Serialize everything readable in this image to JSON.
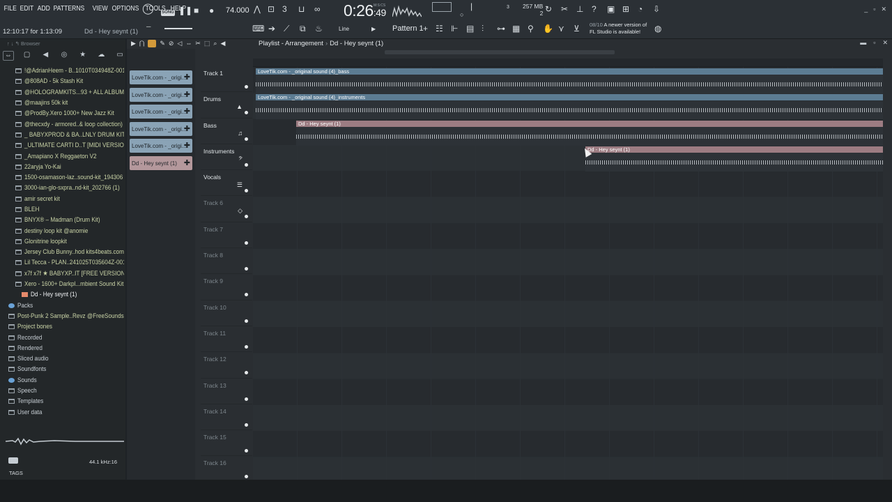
{
  "menu": [
    "FILE",
    "EDIT",
    "ADD",
    "PATTERNS",
    "VIEW",
    "OPTIONS",
    "TOOLS",
    "HELP"
  ],
  "hint": {
    "time": "12:10:17 for 1:13:09",
    "project": "Dd - Hey seynt (1)"
  },
  "transport": {
    "mode": "SONG",
    "tempo": "74.000",
    "clock_main": "0:26",
    "clock_sub": ":49",
    "clock_unit": "M:S:CS"
  },
  "system": {
    "ram": "257 MB",
    "ram_sub": "2",
    "step": "3"
  },
  "toolbar": {
    "line_label": "Line",
    "pattern_label": "Pattern 1"
  },
  "news": {
    "count": "08/10",
    "message_1": "A newer version of",
    "message_2": "FL Studio is available!"
  },
  "browser": {
    "header": "Browser",
    "items": [
      {
        "label": "!@AdrianHeem - B..1010T034948Z-001",
        "type": "folder"
      },
      {
        "label": "@808AD - 5k Stash Kit",
        "type": "folder"
      },
      {
        "label": "@HOLOGRAMKITS...93 + ALL ALBUMS)",
        "type": "folder"
      },
      {
        "label": "@maajins 50k kit",
        "type": "folder"
      },
      {
        "label": "@ProdBy.Xero 1000+ New Jazz Kit",
        "type": "folder"
      },
      {
        "label": "@thecxdy - armored..& loop collection)",
        "type": "folder"
      },
      {
        "label": "_ BABYXPROD & BA..LNLY DRUM KIT V2",
        "type": "folder"
      },
      {
        "label": "_ULTIMATE CARTI D..T [MIDI VERSION]",
        "type": "folder"
      },
      {
        "label": "_Amapiano X Reggaeton V2",
        "type": "folder"
      },
      {
        "label": "22aryja Yo-Kai",
        "type": "folder"
      },
      {
        "label": "1500-osamason-laz..sound-kit_194306",
        "type": "folder"
      },
      {
        "label": "3000-ian-glo-sxpra..nd-kit_202766 (1)",
        "type": "folder"
      },
      {
        "label": "amir secret kit",
        "type": "folder"
      },
      {
        "label": "BLEH",
        "type": "folder"
      },
      {
        "label": "BNYX® – Madman (Drum Kit)",
        "type": "folder"
      },
      {
        "label": "destiny loop kit @anomie",
        "type": "folder"
      },
      {
        "label": "Glonitrine loopkit",
        "type": "folder"
      },
      {
        "label": "Jersey Club Bunny..hod kits4beats.com",
        "type": "folder"
      },
      {
        "label": "Lil Tecca - PLAN..241025T035604Z-001",
        "type": "folder"
      },
      {
        "label": "x7f  x7f ★ BABYXP..IT [FREE VERSION]",
        "type": "folder"
      },
      {
        "label": "Xero - 1600+ Darkpl...mbient Sound Kit",
        "type": "folder"
      },
      {
        "label": "Dd - Hey seynt (1)",
        "type": "selected"
      }
    ],
    "roots": [
      {
        "label": "Packs",
        "type": "special"
      },
      {
        "label": "Post-Punk 2 Sample..Revz @FreeSounds1",
        "type": "root-green"
      },
      {
        "label": "Project bones",
        "type": "root-green"
      },
      {
        "label": "Recorded",
        "type": "root"
      },
      {
        "label": "Rendered",
        "type": "root"
      },
      {
        "label": "Sliced audio",
        "type": "root"
      },
      {
        "label": "Soundfonts",
        "type": "root"
      },
      {
        "label": "Sounds",
        "type": "special"
      },
      {
        "label": "Speech",
        "type": "root"
      },
      {
        "label": "Templates",
        "type": "root"
      },
      {
        "label": "User data",
        "type": "root"
      }
    ],
    "sample_rate": "44.1 kHz:16",
    "tags_label": "TAGS"
  },
  "playlist": {
    "title": "Playlist - Arrangement",
    "sep": "›",
    "pattern": "Dd - Hey seynt (1)",
    "picker": [
      {
        "label": "LoveTik.com - _origi...",
        "color": "blue"
      },
      {
        "label": "LoveTik.com - _origi...",
        "color": "blue"
      },
      {
        "label": "LoveTik.com - _origi...",
        "color": "blue"
      },
      {
        "label": "LoveTik.com - _origi...",
        "color": "blue"
      },
      {
        "label": "LoveTik.com - _origi...",
        "color": "blue"
      },
      {
        "label": "Dd - Hey seynt (1)",
        "color": "pink"
      }
    ],
    "tracks": [
      {
        "name": "Track 1",
        "icon": ""
      },
      {
        "name": "Drums",
        "icon": "▲"
      },
      {
        "name": "Bass",
        "icon": "♫"
      },
      {
        "name": "Instruments",
        "icon": "𝄢"
      },
      {
        "name": "Vocals",
        "icon": "☰"
      },
      {
        "name": "Track 6",
        "icon": "◇"
      },
      {
        "name": "Track 7",
        "icon": ""
      },
      {
        "name": "Track 8",
        "icon": ""
      },
      {
        "name": "Track 9",
        "icon": ""
      },
      {
        "name": "Track 10",
        "icon": ""
      },
      {
        "name": "Track 11",
        "icon": ""
      },
      {
        "name": "Track 12",
        "icon": ""
      },
      {
        "name": "Track 13",
        "icon": ""
      },
      {
        "name": "Track 14",
        "icon": ""
      },
      {
        "name": "Track 15",
        "icon": ""
      },
      {
        "name": "Track 16",
        "icon": ""
      }
    ],
    "clips": [
      {
        "label": "LoveTik.com - _original sound (4)_bass",
        "color": "blue"
      },
      {
        "label": "LoveTik.com - _original sound (4)_instruments",
        "color": "blue"
      },
      {
        "label": "Dd - Hey seynt (1)",
        "color": "pink"
      },
      {
        "label": "Dd - Hey seynt (1)",
        "color": "pink"
      }
    ]
  }
}
